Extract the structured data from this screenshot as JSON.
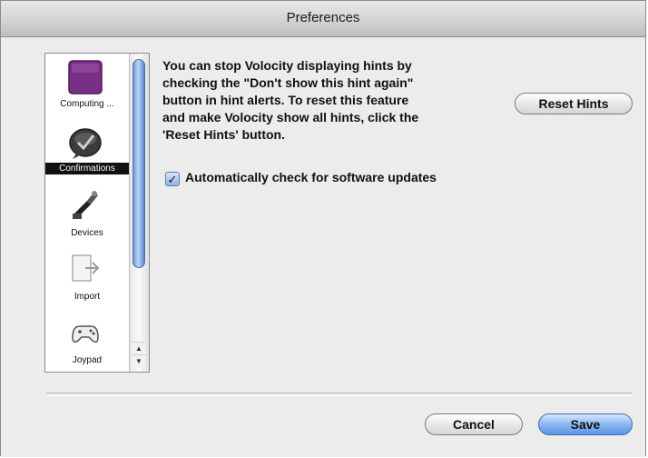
{
  "window": {
    "title": "Preferences"
  },
  "sidebar": {
    "items": [
      {
        "label": "Computing ...",
        "icon": "computing-icon"
      },
      {
        "label": "Confirmations",
        "icon": "confirmations-icon",
        "selected": true
      },
      {
        "label": "Devices",
        "icon": "devices-icon"
      },
      {
        "label": "Import",
        "icon": "import-icon"
      },
      {
        "label": "Joypad",
        "icon": "joypad-icon"
      }
    ]
  },
  "main": {
    "description_lines": [
      "You can stop Volocity displaying hints by",
      "checking the \"Don't show this hint again\"",
      "button in hint alerts.  To reset this feature",
      "and make Volocity show all hints, click the",
      "'Reset Hints' button."
    ],
    "reset_hints_label": "Reset Hints",
    "auto_update_label": "Automatically check for software updates",
    "auto_update_checked": true
  },
  "footer": {
    "cancel_label": "Cancel",
    "save_label": "Save"
  },
  "colors": {
    "accent": "#5d97e3",
    "selected_item": "#111111"
  }
}
